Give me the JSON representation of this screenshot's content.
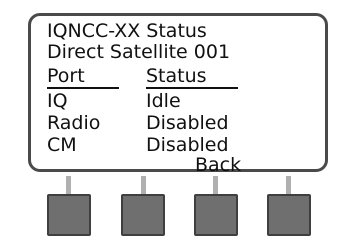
{
  "display": {
    "line1": "IQNCC-XX Status",
    "line2": "Direct Satellite 001",
    "headers": {
      "port": "Port",
      "status": "Status"
    },
    "rows": [
      {
        "port": "IQ",
        "status": "Idle"
      },
      {
        "port": "Radio",
        "status": "Disabled"
      },
      {
        "port": "CM",
        "status": "Disabled"
      }
    ],
    "back_label": "Back"
  },
  "colors": {
    "screen_border": "#4a4a4a",
    "button_fill": "#6f6f6f",
    "stem": "#b0b0b0"
  }
}
